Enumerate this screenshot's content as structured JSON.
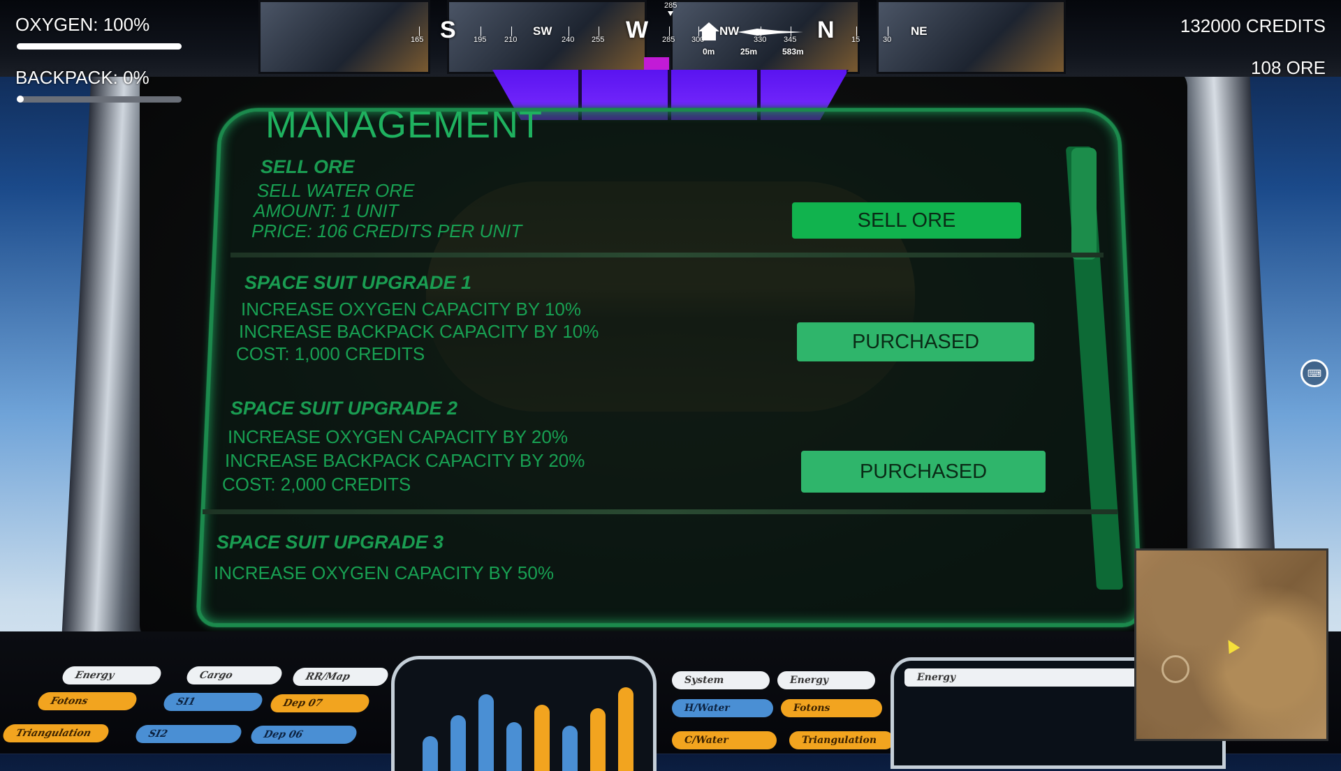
{
  "hud": {
    "oxygen_label": "OXYGEN: 100%",
    "oxygen_level": 1.0,
    "backpack_label": "BACKPACK: 0%",
    "backpack_level": 0.0,
    "credits": "132000 CREDITS",
    "ore": "108 ORE"
  },
  "compass": {
    "majors": [
      "S",
      "W",
      "N"
    ],
    "minors": [
      "SW",
      "NW",
      "NE"
    ],
    "heading_marker": "285",
    "degrees": [
      "165",
      "195",
      "210",
      "240",
      "255",
      "285",
      "300",
      "330",
      "345",
      "15",
      "30"
    ],
    "distances": [
      "0m",
      "25m",
      "583m"
    ],
    "icons": [
      "home-icon",
      "ship-icon"
    ]
  },
  "management": {
    "title": "MANAGEMENT",
    "sell_ore": {
      "heading": "SELL ORE",
      "lines": [
        "SELL WATER ORE",
        "AMOUNT: 1 UNIT",
        "PRICE: 106 CREDITS PER UNIT"
      ],
      "button": "SELL ORE"
    },
    "upgrade1": {
      "heading": "SPACE SUIT UPGRADE 1",
      "lines": [
        "INCREASE OXYGEN CAPACITY BY 10%",
        "INCREASE BACKPACK CAPACITY BY 10%",
        "COST: 1,000 CREDITS"
      ],
      "button": "PURCHASED"
    },
    "upgrade2": {
      "heading": "SPACE SUIT UPGRADE 2",
      "lines": [
        "INCREASE OXYGEN CAPACITY BY 20%",
        "INCREASE BACKPACK CAPACITY BY 20%",
        "COST: 2,000 CREDITS"
      ],
      "button": "PURCHASED"
    },
    "upgrade3": {
      "heading": "SPACE SUIT UPGRADE 3",
      "lines": [
        "INCREASE OXYGEN CAPACITY BY 50%"
      ]
    }
  },
  "console": {
    "left_pills": [
      "Energy",
      "Cargo",
      "RR/Map",
      "Fotons",
      "SI1",
      "Dep 07",
      "Triangulation",
      "SI2",
      "Dep 06"
    ],
    "center_pills": [
      "System",
      "Energy",
      "H/Water",
      "Fotons",
      "C/Water",
      "Triangulation"
    ],
    "right_label": "Energy"
  },
  "colors": {
    "panel_green": "#1fb15f",
    "button_green": "#11b34e",
    "purchased_green": "#2fb56b",
    "accent_purple": "#6a1ff5"
  }
}
